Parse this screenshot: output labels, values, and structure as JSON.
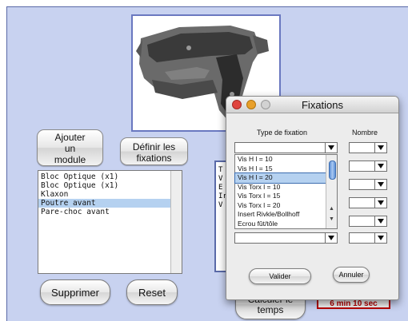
{
  "main": {
    "buttons": {
      "add_module": "Ajouter\nun\nmodule",
      "define_fixations": "Définir les\nfixations",
      "delete": "Supprimer",
      "reset": "Reset",
      "calculate_time": "Calculer le\ntemps"
    },
    "modules_list": [
      {
        "label": "Bloc Optique (x1)",
        "selected": false
      },
      {
        "label": "Bloc Optique (x1)",
        "selected": false
      },
      {
        "label": "Klaxon",
        "selected": false
      },
      {
        "label": "Poutre avant",
        "selected": true
      },
      {
        "label": "Pare-choc avant",
        "selected": false
      }
    ],
    "side_list_fragments": [
      "T",
      "V",
      "E",
      "Ir",
      "V"
    ],
    "time_display": "6 min  10 sec",
    "time_display_color": "#b80000"
  },
  "dialog": {
    "title": "Fixations",
    "col_type_header": "Type de fixation",
    "col_count_header": "Nombre",
    "fixation_options": [
      {
        "label": "Vis H l = 10",
        "selected": false
      },
      {
        "label": "Vis H l = 15",
        "selected": false
      },
      {
        "label": "Vis H l = 20",
        "selected": true
      },
      {
        "label": "Vis Torx l = 10",
        "selected": false
      },
      {
        "label": "Vis Torx l = 15",
        "selected": false
      },
      {
        "label": "Vis Torx l = 20",
        "selected": false
      },
      {
        "label": "Insert Rivkle/Bollhoff",
        "selected": false
      },
      {
        "label": "Ecrou fût/tôle",
        "selected": false
      }
    ],
    "validate_label": "Valider",
    "cancel_label": "Annuler",
    "traffic_lights": {
      "close": "#e0443e",
      "minimize": "#e8a02b",
      "zoom": "#cfcfcf"
    }
  }
}
